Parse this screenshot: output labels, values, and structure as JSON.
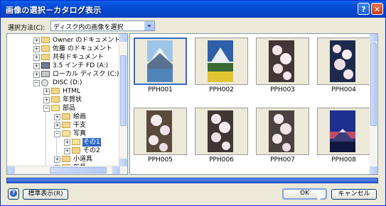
{
  "window": {
    "title": "画像の選択－カタログ表示"
  },
  "titlebar": {
    "help_glyph": "?",
    "close_glyph": "✕"
  },
  "toolbar": {
    "select_label": "選択方法(C):",
    "combo_value": "ディスク内の画像を選択"
  },
  "tree": {
    "items": [
      {
        "label": "Owner のドキュメント",
        "icon": "folder-icon"
      },
      {
        "label": "佐藤 のドキュメント",
        "icon": "folder-icon"
      },
      {
        "label": "共有ドキュメント",
        "icon": "folder-icon"
      },
      {
        "label": "3.5 インチ FD (A:)",
        "icon": "floppy-icon"
      },
      {
        "label": "ローカル ディスク (C:)",
        "icon": "drive-icon"
      },
      {
        "label": "DISC (D:)",
        "icon": "disc-icon"
      },
      {
        "label": "HTML",
        "icon": "folder-icon"
      },
      {
        "label": "年賀状",
        "icon": "folder-icon"
      },
      {
        "label": "部品",
        "icon": "folder-icon"
      },
      {
        "label": "絵画",
        "icon": "folder-icon"
      },
      {
        "label": "干支",
        "icon": "folder-icon"
      },
      {
        "label": "写真",
        "icon": "folder-icon"
      },
      {
        "label": "その1",
        "icon": "folder-open-icon"
      },
      {
        "label": "その2",
        "icon": "folder-icon"
      },
      {
        "label": "小道具",
        "icon": "folder-icon"
      },
      {
        "label": "年号",
        "icon": "folder-icon"
      }
    ]
  },
  "thumbnails": [
    {
      "name": "PPH001",
      "subject": "fuji-lake"
    },
    {
      "name": "PPH002",
      "subject": "fuji-flowers"
    },
    {
      "name": "PPH003",
      "subject": "cherry-blossom"
    },
    {
      "name": "PPH004",
      "subject": "cherry-blossom"
    },
    {
      "name": "PPH005",
      "subject": "cherry-blossom"
    },
    {
      "name": "PPH006",
      "subject": "cherry-blossom"
    },
    {
      "name": "PPH007",
      "subject": "cherry-blossom"
    },
    {
      "name": "PPH008",
      "subject": "fuji-dusk"
    }
  ],
  "footer": {
    "standard_view_label": "標準表示(R)",
    "ok_label": "OK",
    "cancel_label": "キャンセル"
  },
  "colors": {
    "titlebar": "#0549d6",
    "selection": "#316ac5"
  }
}
